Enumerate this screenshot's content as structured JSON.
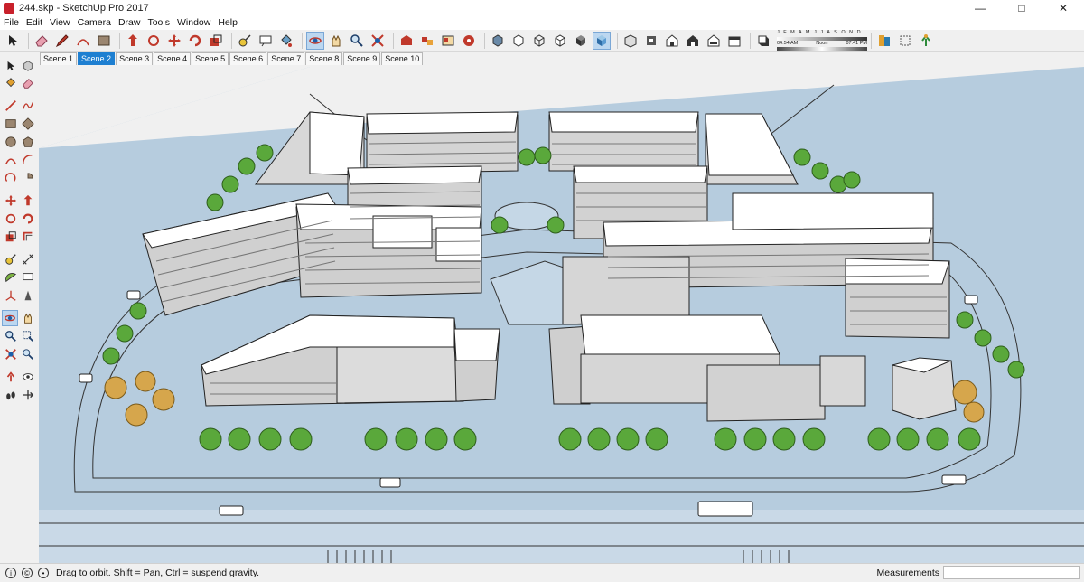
{
  "window": {
    "title": "244.skp - SketchUp Pro 2017",
    "minimize_glyph": "—",
    "maximize_glyph": "□",
    "close_glyph": "✕"
  },
  "menu": [
    "File",
    "Edit",
    "View",
    "Camera",
    "Draw",
    "Tools",
    "Window",
    "Help"
  ],
  "shadow_panel": {
    "months": "J F M A M J J A S O N D",
    "time_start": "04:54 AM",
    "time_mid": "Noon",
    "time_end": "07:41 PM"
  },
  "scene_tabs": [
    "Scene 1",
    "Scene 2",
    "Scene 3",
    "Scene 4",
    "Scene 5",
    "Scene 6",
    "Scene 7",
    "Scene 8",
    "Scene 9",
    "Scene 10"
  ],
  "active_scene": "Scene 2",
  "toolbar_icons": [
    "select-icon",
    "eraser-icon",
    "pencil-icon",
    "arc-icon",
    "rectangle-icon",
    "push-pull-icon",
    "rotate-icon",
    "move-icon",
    "follow-me-icon",
    "scale-icon",
    "tape-measure-icon",
    "text-icon",
    "paint-bucket-icon",
    "orbit-icon",
    "pan-icon",
    "zoom-icon",
    "zoom-extents-icon",
    "warehouse-icon",
    "extension-warehouse-icon",
    "components-icon",
    "share-icon",
    "xray-icon",
    "back-edges-icon",
    "wireframe-icon",
    "hidden-line-icon",
    "shaded-icon",
    "shaded-textures-icon",
    "iso-view-icon",
    "top-view-icon",
    "front-view-icon",
    "right-view-icon",
    "back-view-icon",
    "left-view-icon",
    "shadows-icon",
    "section-plane-icon",
    "section-display-icon",
    "position-camera-icon"
  ],
  "status": {
    "text": "Drag to orbit. Shift = Pan, Ctrl = suspend gravity.",
    "measurements_label": "Measurements",
    "measurements_value": ""
  },
  "colors": {
    "sky": "#f0f0f0",
    "ground": "#b6ccde",
    "building": "#ffffff",
    "facade": "#d4d4d4",
    "tree": "#5aa83b",
    "tree_autumn": "#d6a64c",
    "accent": "#1e7fd1"
  }
}
